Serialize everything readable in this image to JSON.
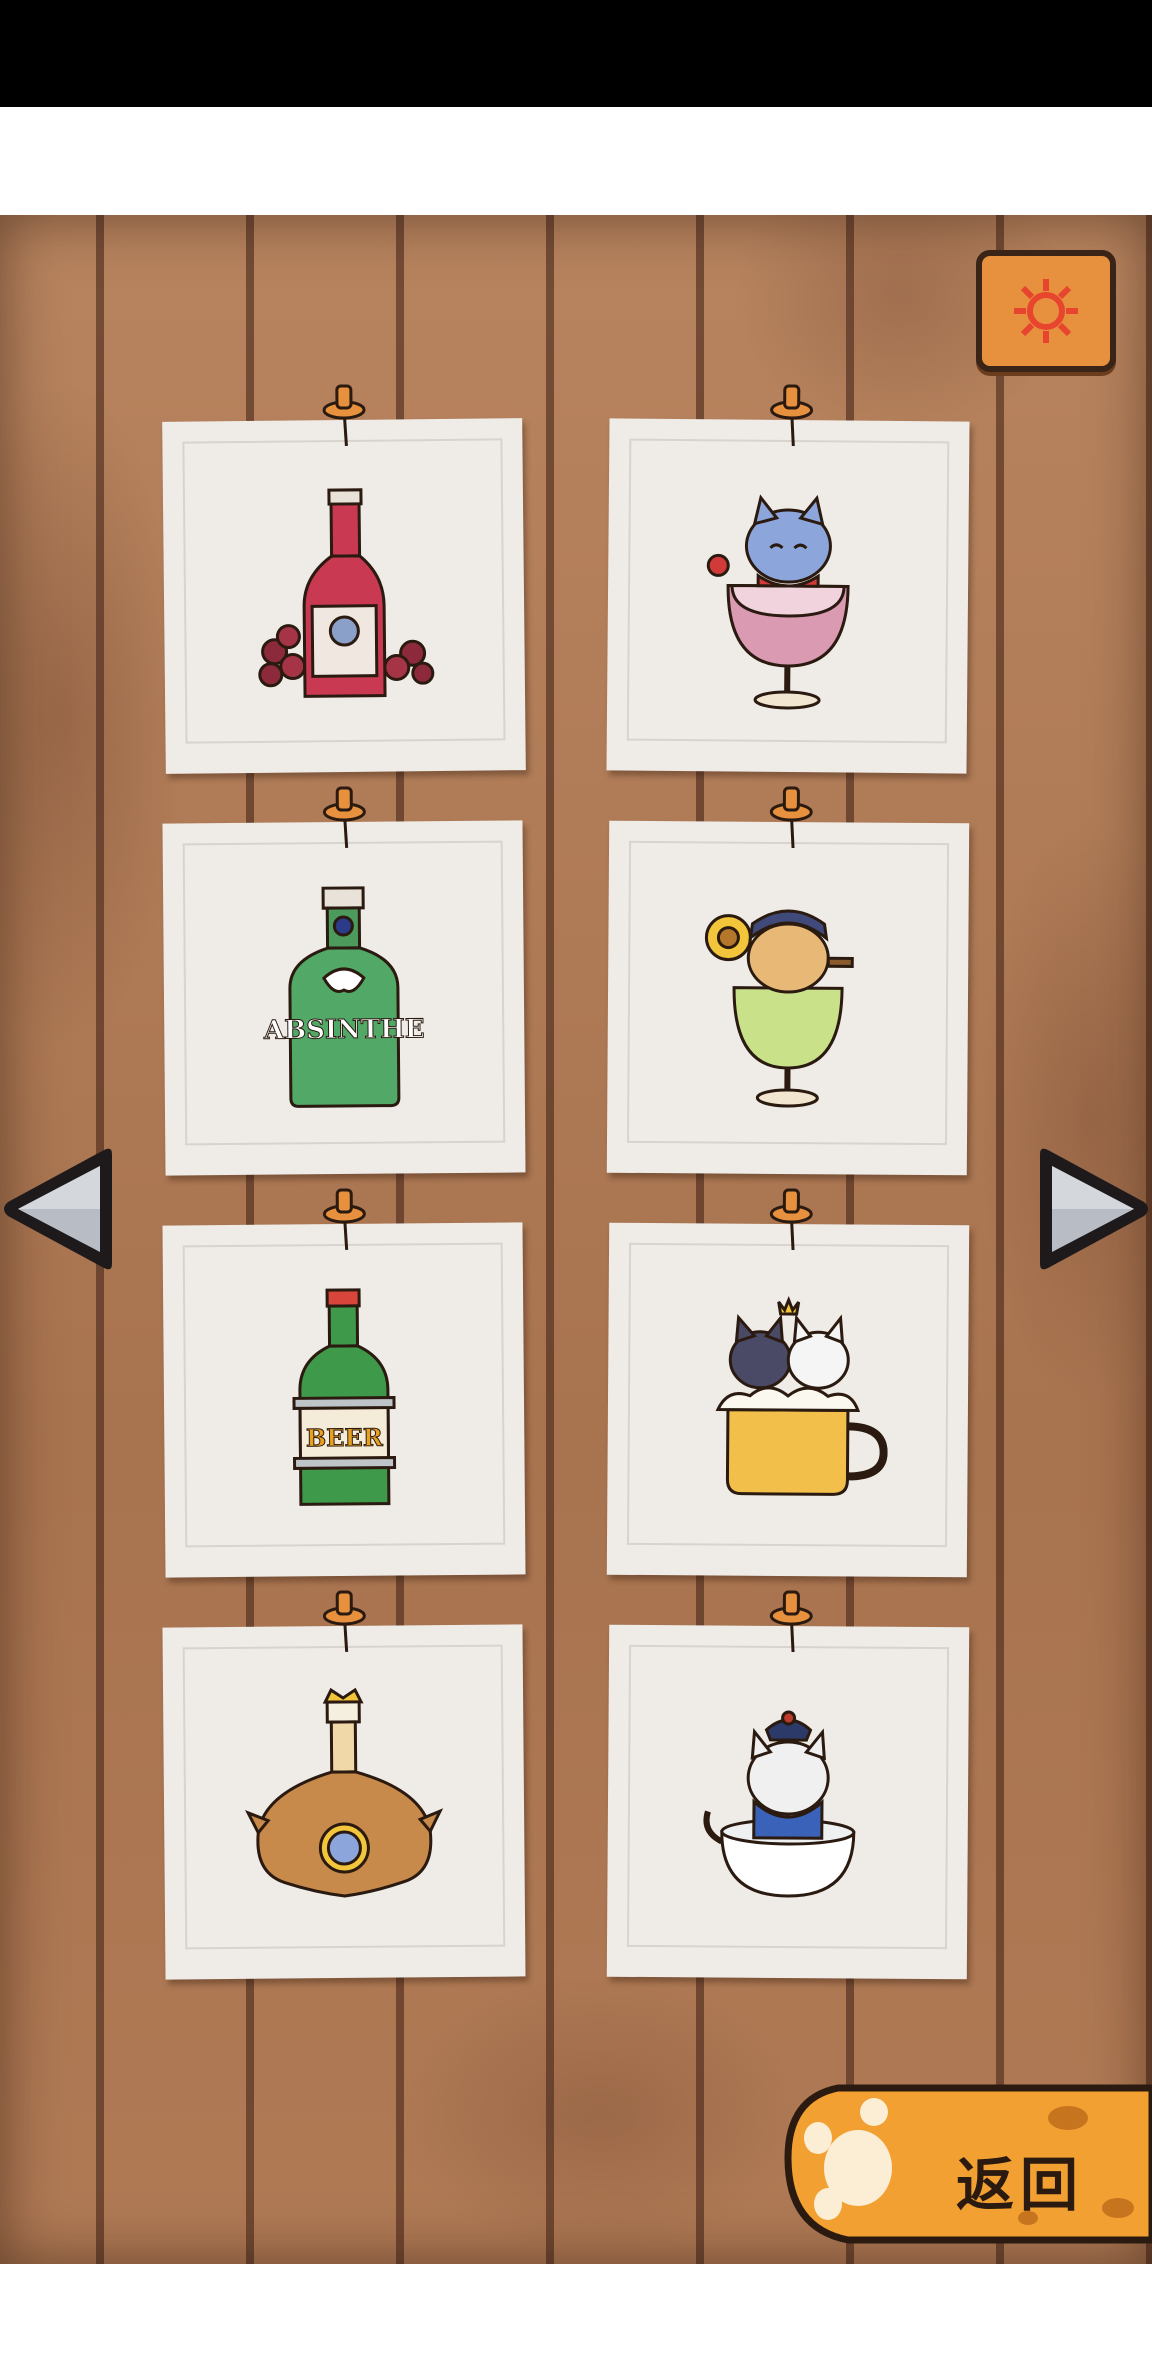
{
  "screen": {
    "back_label": "返回"
  },
  "icons": {
    "settings": "gear-icon",
    "prev": "left-arrow-icon",
    "next": "right-arrow-icon",
    "back": "cat-paw-icon"
  },
  "colors": {
    "board_wood": "#b07a55",
    "card": "#efebe7",
    "accent_orange": "#e7913f",
    "gear_red": "#e8452f"
  },
  "cards": [
    {
      "name": "red-wine-bottle"
    },
    {
      "name": "cat-in-wine-glass"
    },
    {
      "name": "absinthe-bottle"
    },
    {
      "name": "cat-in-absinthe-glass"
    },
    {
      "name": "beer-bottle"
    },
    {
      "name": "cats-in-beer-mug"
    },
    {
      "name": "spirit-bottle"
    },
    {
      "name": "cat-in-bowl"
    }
  ],
  "art_text": {
    "absinthe": "ABSINTHE",
    "beer": "BEER"
  }
}
